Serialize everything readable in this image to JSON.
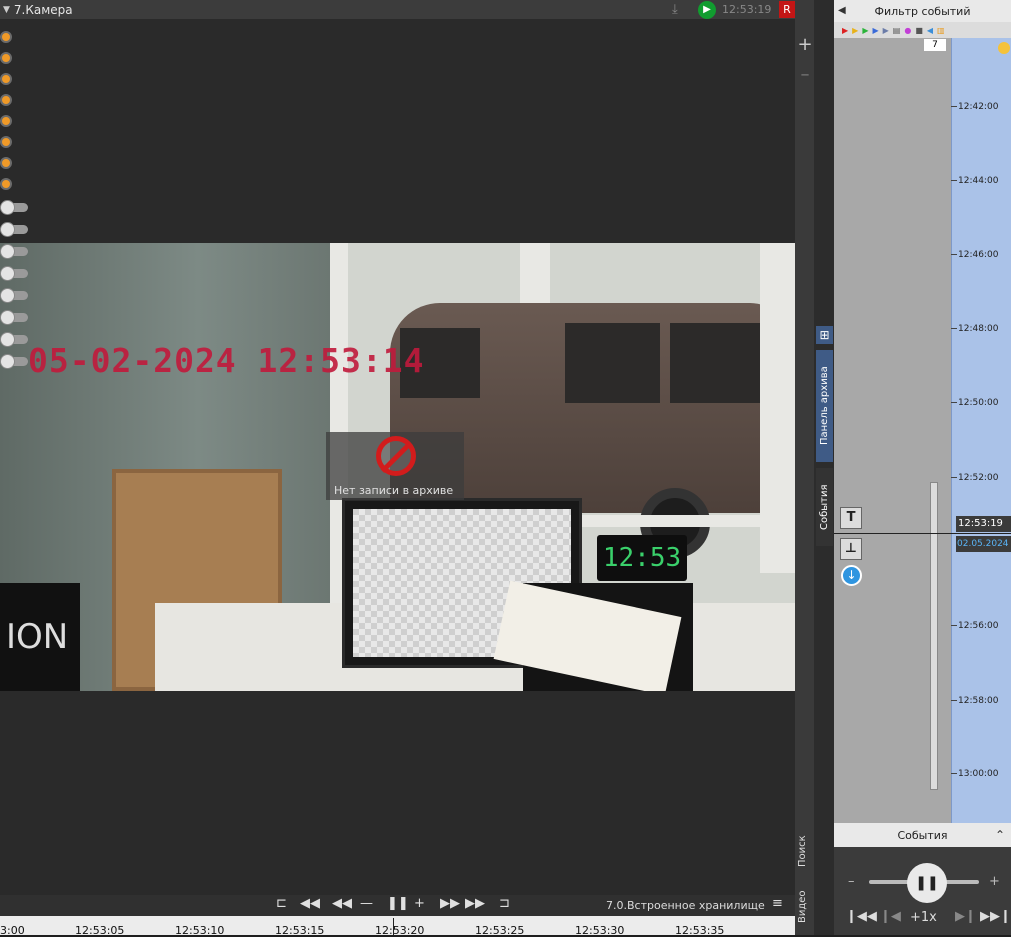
{
  "camera": {
    "title": "7.Камера",
    "time": "12:53:19",
    "rec_label": "R",
    "osd_text": "05-02-2024 12:53:14",
    "no_archive_text": "Нет записи в архиве",
    "clock_display": "12:53",
    "sign_text": "ION"
  },
  "side_tabs": {
    "search": "Поиск",
    "video": "Видео",
    "archive_panel": "Панель архива",
    "events": "События"
  },
  "filter_panel": {
    "title": "Фильтр событий",
    "count_badge": "7",
    "ticks": [
      "12:42:00",
      "12:44:00",
      "12:46:00",
      "12:48:00",
      "12:50:00",
      "12:52:00",
      "12:56:00",
      "12:58:00",
      "13:00:00"
    ],
    "cursor_time": "12:53:19",
    "cursor_date": "02.05.2024"
  },
  "events_panel": {
    "title": "События",
    "speed_label": "+1x",
    "minus": "–",
    "plus": "+"
  },
  "playback": {
    "storage": "7.0.Встроенное хранилище",
    "ticks": [
      "3:00",
      "12:53:05",
      "12:53:10",
      "12:53:15",
      "12:53:20",
      "12:53:25",
      "12:53:30",
      "12:53:35"
    ]
  }
}
